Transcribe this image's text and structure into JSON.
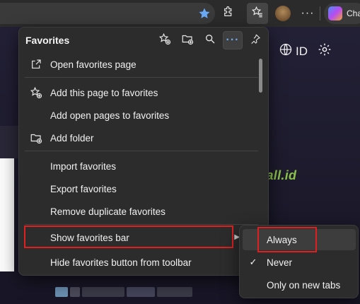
{
  "browser": {
    "copilot_label": "Cha"
  },
  "page": {
    "lang_label": "ID",
    "watermark_text": "nginstall.id"
  },
  "favorites_menu": {
    "title": "Favorites",
    "items": [
      {
        "label": "Open favorites page",
        "icon": "external-link-icon"
      },
      {
        "label": "Add this page to favorites",
        "icon": "star-add-icon"
      },
      {
        "label": "Add open pages to favorites",
        "icon": ""
      },
      {
        "label": "Add folder",
        "icon": "folder-add-icon"
      },
      {
        "label": "Import favorites",
        "icon": ""
      },
      {
        "label": "Export favorites",
        "icon": ""
      },
      {
        "label": "Remove duplicate favorites",
        "icon": ""
      },
      {
        "label": "Show favorites bar",
        "icon": ""
      },
      {
        "label": "Hide favorites button from toolbar",
        "icon": ""
      }
    ]
  },
  "submenu": {
    "items": [
      {
        "label": "Always",
        "checked": false
      },
      {
        "label": "Never",
        "checked": true
      },
      {
        "label": "Only on new tabs",
        "checked": false
      }
    ]
  },
  "colors": {
    "highlight_box": "#e02020",
    "menu_bg": "#2c2c2c"
  }
}
